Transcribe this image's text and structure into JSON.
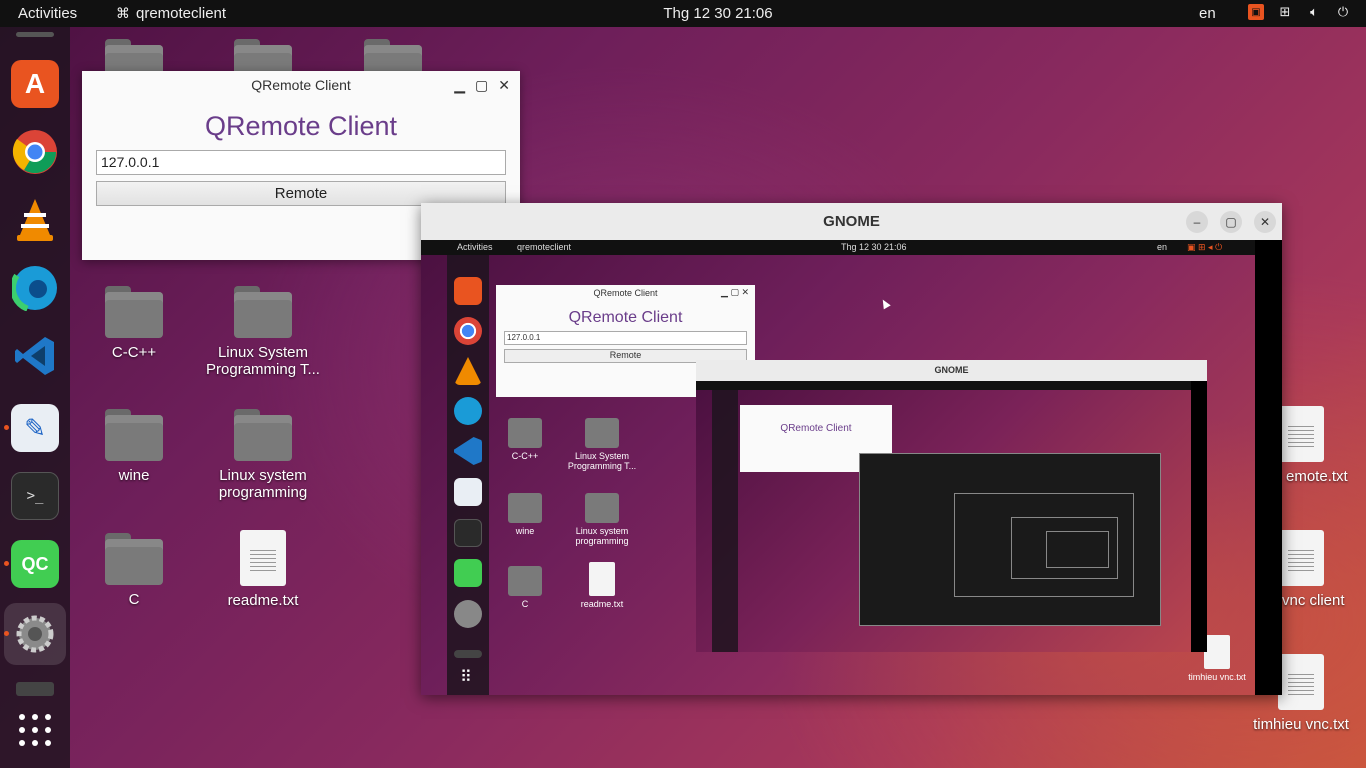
{
  "topbar": {
    "activities": "Activities",
    "app_name": "qremoteclient",
    "clock": "Thg 12 30  21:06",
    "lang": "en"
  },
  "dock": {
    "items": [
      {
        "name": "app-center",
        "color": "#e95420",
        "glyph": "A"
      },
      {
        "name": "chrome",
        "color": "#4285f4",
        "glyph": "●"
      },
      {
        "name": "vlc",
        "color": "#f08a00",
        "glyph": "▲"
      },
      {
        "name": "edge",
        "color": "#1a9bd7",
        "glyph": "e"
      },
      {
        "name": "vscode",
        "color": "#1f78c8",
        "glyph": "⋊"
      },
      {
        "name": "text-editor",
        "color": "#e9eef4",
        "glyph": "✎"
      },
      {
        "name": "terminal",
        "color": "#333333",
        "glyph": ">_"
      },
      {
        "name": "qt-creator",
        "color": "#41cd52",
        "glyph": "QC"
      },
      {
        "name": "settings",
        "color": "#777777",
        "glyph": "⚙"
      }
    ]
  },
  "desktop": {
    "icons": [
      {
        "label": "C-C++",
        "type": "folder"
      },
      {
        "label": "Linux System Programming T...",
        "type": "folder"
      },
      {
        "label": "wine",
        "type": "folder"
      },
      {
        "label": "Linux system programming",
        "type": "folder"
      },
      {
        "label": "C",
        "type": "folder"
      },
      {
        "label": "readme.txt",
        "type": "file"
      },
      {
        "label": "emote.txt",
        "type": "file"
      },
      {
        "label": "vnc client",
        "type": "file"
      },
      {
        "label": "timhieu vnc.txt",
        "type": "file"
      }
    ]
  },
  "qremote_window": {
    "title": "QRemote Client",
    "heading": "QRemote Client",
    "ip_value": "127.0.0.1",
    "remote_button": "Remote"
  },
  "gnome_window": {
    "title": "GNOME",
    "inner": {
      "activities": "Activities",
      "app_name": "qremoteclient",
      "clock": "Thg 12 30  21:06",
      "lang": "en",
      "q_title": "QRemote Client",
      "q_heading": "QRemote Client",
      "q_ip": "127.0.0.1",
      "q_button": "Remote",
      "icons": [
        "C-C++",
        "Linux System Programming T...",
        "wine",
        "Linux system programming",
        "C",
        "readme.txt",
        "timhieu vnc.txt"
      ],
      "nested_title": "GNOME",
      "nested_q_heading": "QRemote Client"
    }
  }
}
